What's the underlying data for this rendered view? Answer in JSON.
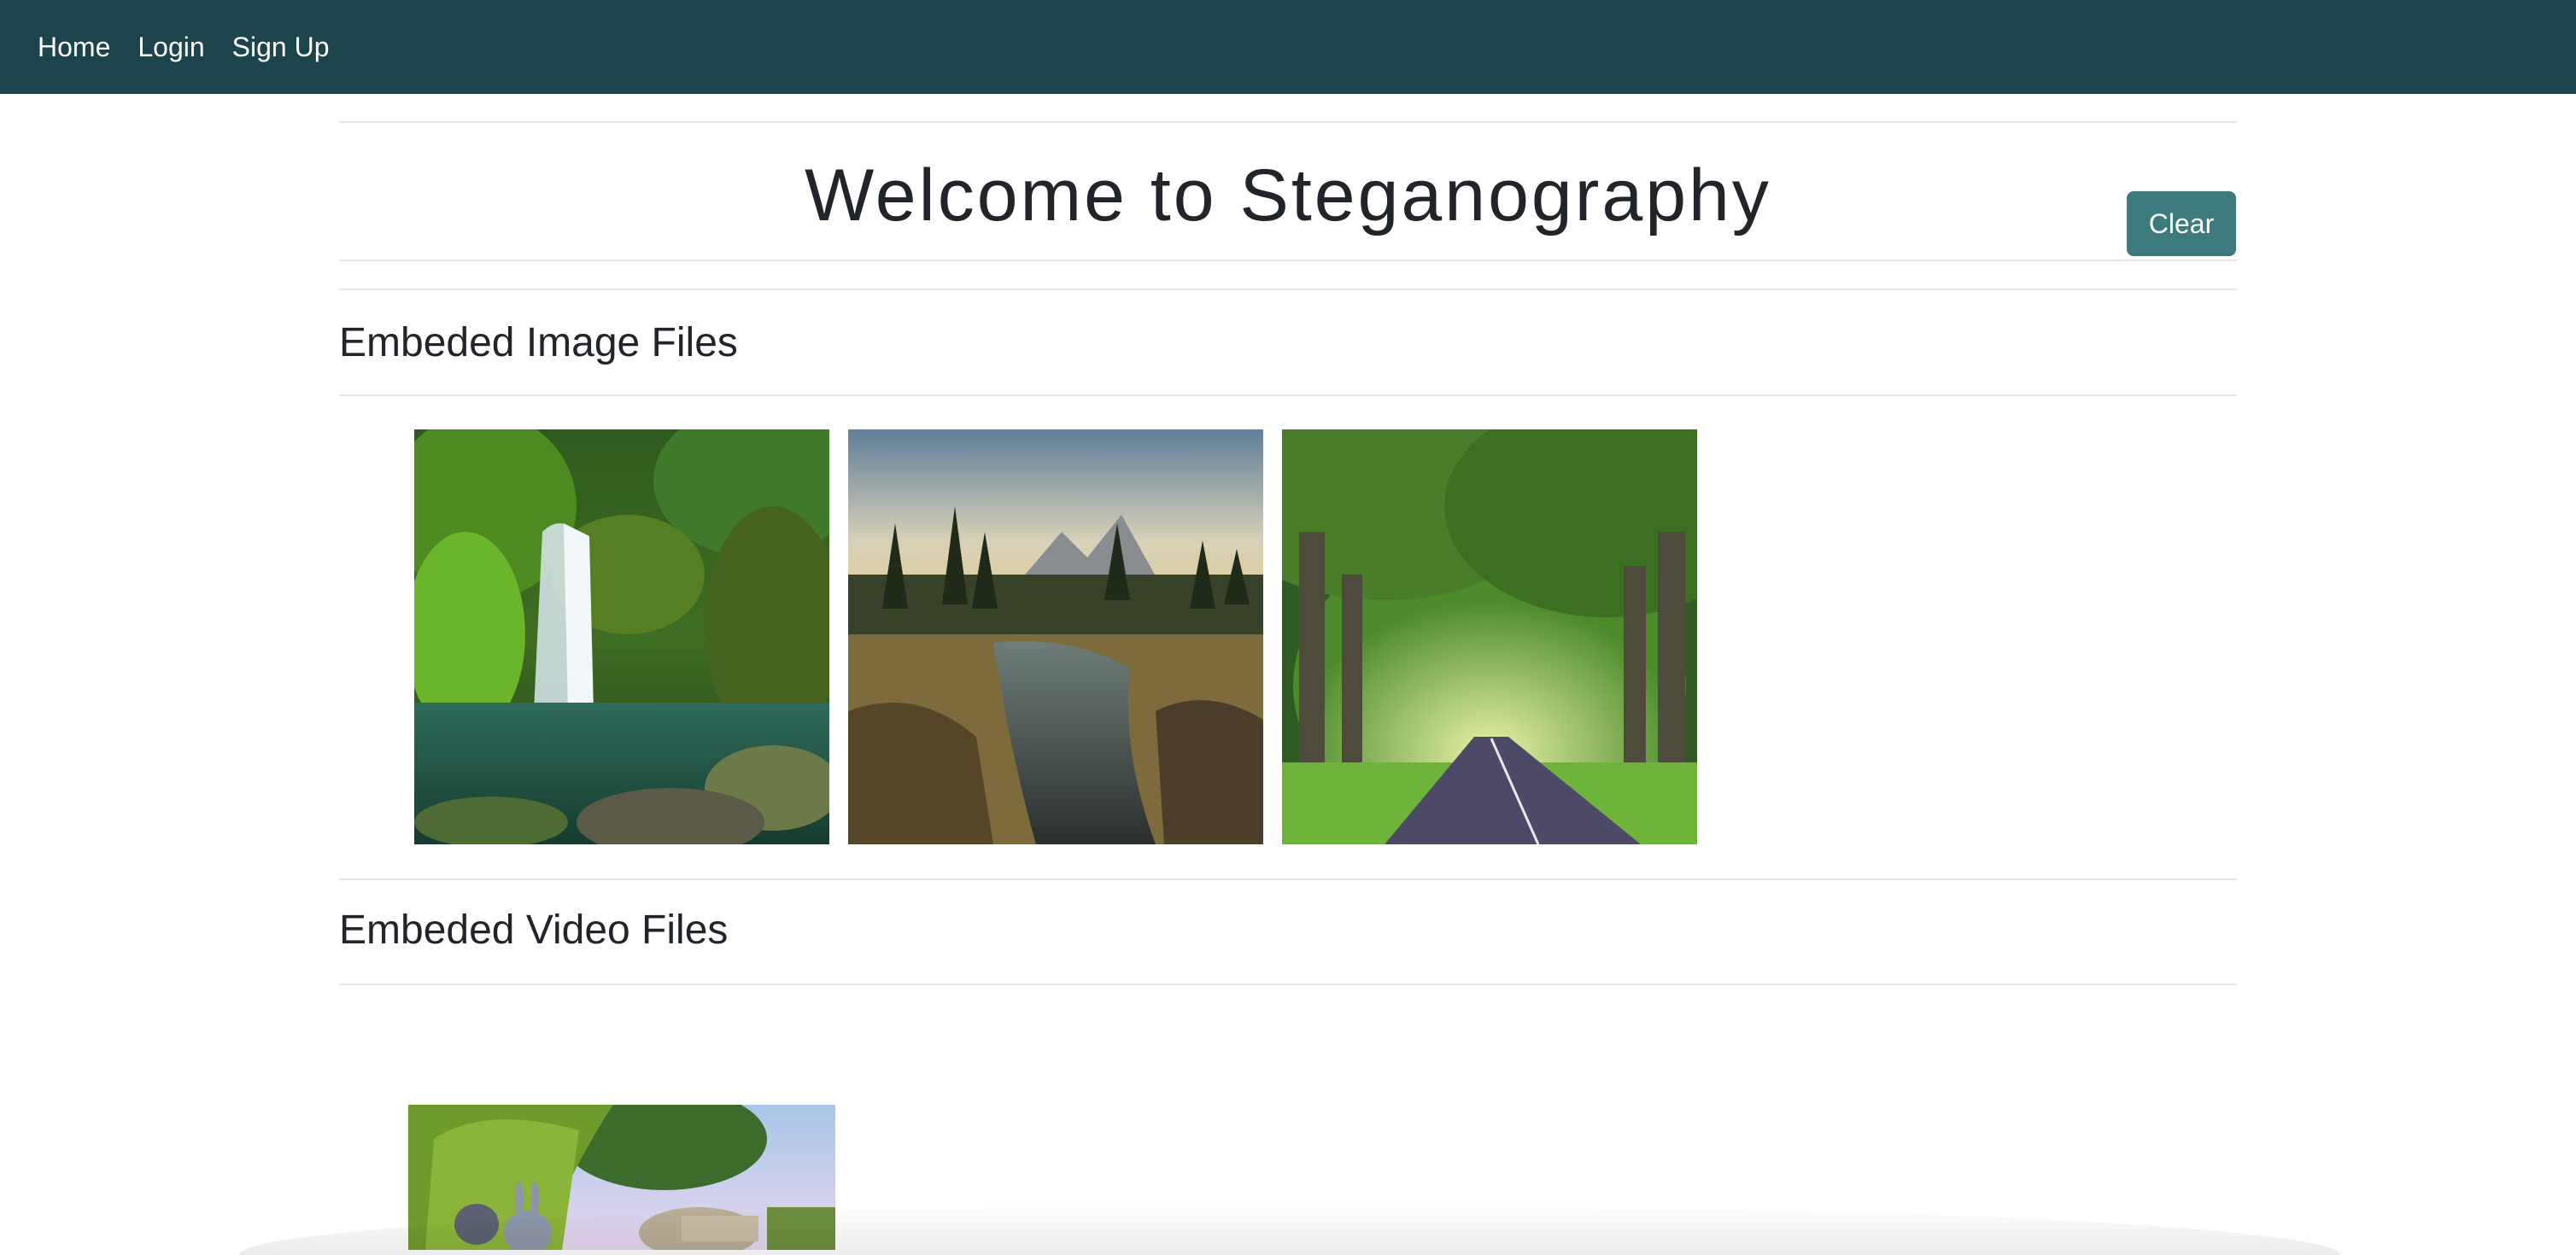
{
  "nav": {
    "items": [
      {
        "label": "Home"
      },
      {
        "label": "Login"
      },
      {
        "label": "Sign Up"
      }
    ]
  },
  "page": {
    "title": "Welcome to Steganography",
    "clear_label": "Clear"
  },
  "sections": {
    "images": {
      "heading": "Embeded Image Files",
      "items": [
        {
          "icon": "waterfall-image"
        },
        {
          "icon": "lake-forest-image"
        },
        {
          "icon": "tree-road-image"
        }
      ]
    },
    "videos": {
      "heading": "Embeded Video Files",
      "items": [
        {
          "icon": "rabbit-video-thumbnail"
        }
      ]
    }
  },
  "colors": {
    "navbar": "#1d434c",
    "button": "#3c7a7d"
  }
}
